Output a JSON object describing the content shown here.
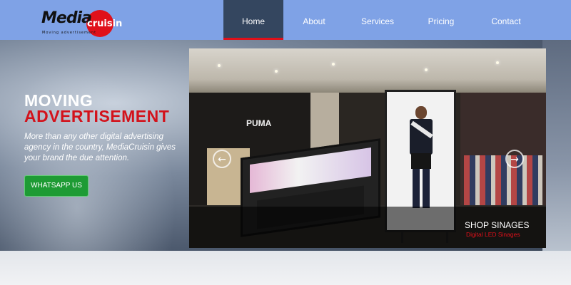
{
  "brand": {
    "logo_word": "Media",
    "logo_cruisin": "cruisin",
    "tagline": "Moving advertisement",
    "accent_color": "#e0101a",
    "header_color": "#7fa2e6"
  },
  "nav": {
    "items": [
      {
        "label": "Home",
        "active": true
      },
      {
        "label": "About"
      },
      {
        "label": "Services"
      },
      {
        "label": "Pricing"
      },
      {
        "label": "Contact"
      }
    ]
  },
  "hero": {
    "heading_line1": "MOVING",
    "heading_line2": "ADVERTISEMENT",
    "description": "More than any other digital advertising agency in the country, MediaCruisin gives your brand the due attention.",
    "cta_label": "WHATSAPP US",
    "cta_color": "#1e9b34"
  },
  "slider": {
    "prev_icon": "chevron-left-icon",
    "next_icon": "chevron-right-icon",
    "prev_glyph": "←",
    "next_glyph": "→",
    "caption_title": "SHOP SINAGES",
    "caption_subtitle": "Digital LED Sinages",
    "image_store_text": "PUMA"
  }
}
